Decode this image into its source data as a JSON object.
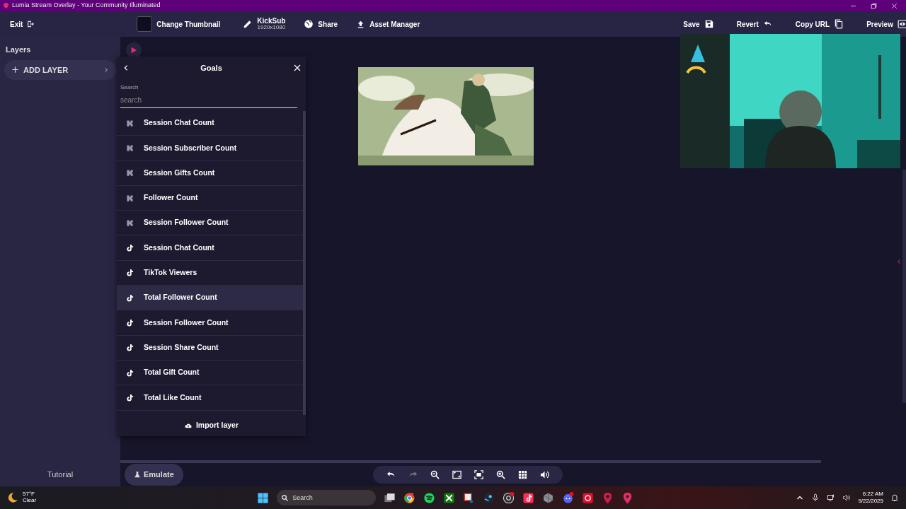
{
  "window": {
    "title": "Lumia Stream Overlay - Your Community Illuminated"
  },
  "toolbar": {
    "exit": "Exit",
    "thumbnail": "Change Thumbnail",
    "overlay_name": "KickSub",
    "resolution": "1920x1080",
    "share": "Share",
    "asset_manager": "Asset Manager",
    "save": "Save",
    "revert": "Revert",
    "copy_url": "Copy URL",
    "preview": "Preview"
  },
  "sidebar": {
    "title": "Layers",
    "add_layer": "ADD LAYER",
    "tutorial": "Tutorial"
  },
  "goals_panel": {
    "title": "Goals",
    "search": {
      "label": "Search",
      "placeholder": "search"
    },
    "items": [
      {
        "label": "Session Chat Count",
        "kind": "kick",
        "selected": false
      },
      {
        "label": "Session Subscriber Count",
        "kind": "kick",
        "selected": false
      },
      {
        "label": "Session Gifts Count",
        "kind": "kick",
        "selected": false
      },
      {
        "label": "Follower Count",
        "kind": "kick",
        "selected": false
      },
      {
        "label": "Session Follower Count",
        "kind": "kick",
        "selected": false
      },
      {
        "label": "Session Chat Count",
        "kind": "tiktok",
        "selected": false
      },
      {
        "label": "TikTok Viewers",
        "kind": "tiktok",
        "selected": false
      },
      {
        "label": "Total Follower Count",
        "kind": "tiktok",
        "selected": true
      },
      {
        "label": "Session Follower Count",
        "kind": "tiktok",
        "selected": false
      },
      {
        "label": "Session Share Count",
        "kind": "tiktok",
        "selected": false
      },
      {
        "label": "Total Gift Count",
        "kind": "tiktok",
        "selected": false
      },
      {
        "label": "Total Like Count",
        "kind": "tiktok",
        "selected": false
      }
    ],
    "import": "Import layer"
  },
  "emulate": "Emulate",
  "taskbar": {
    "weather": {
      "temperature": "57°F",
      "condition": "Clear"
    },
    "search": {
      "placeholder": "Search"
    },
    "time": "6:22 AM",
    "date": "9/22/2025"
  }
}
